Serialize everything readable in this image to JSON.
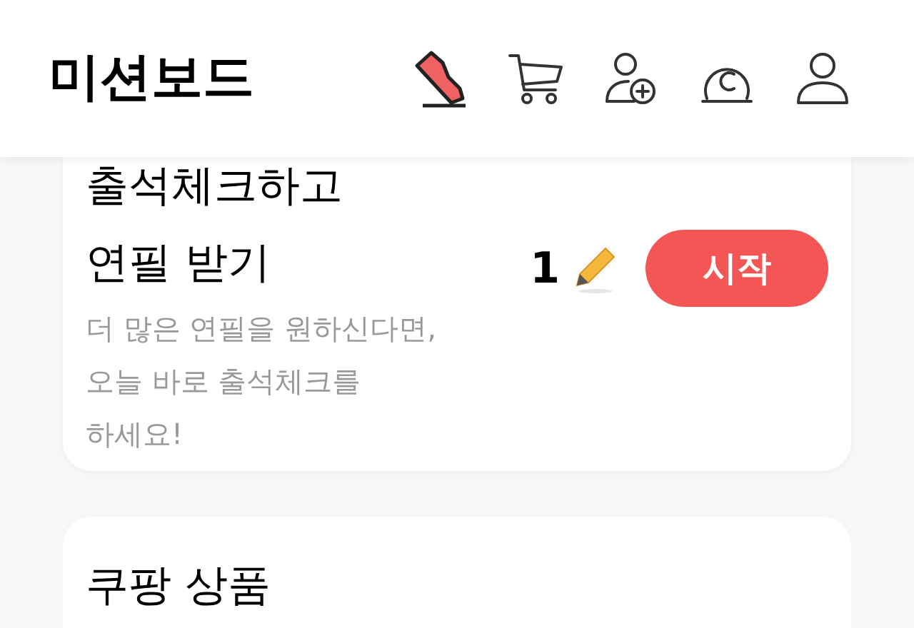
{
  "header": {
    "title": "미션보드",
    "icons": [
      {
        "kind": "shoe"
      },
      {
        "kind": "cart"
      },
      {
        "kind": "add-user"
      },
      {
        "kind": "coin"
      },
      {
        "kind": "user"
      }
    ]
  },
  "missions": [
    {
      "title": "출석체크하고\n연필 받기",
      "description": "더 많은 연필을 원하신다면,\n오늘 바로 출석체크를\n하세요!",
      "reward": "1",
      "button": "시작"
    }
  ],
  "sections": [
    {
      "title": "쿠팡 상품"
    }
  ]
}
